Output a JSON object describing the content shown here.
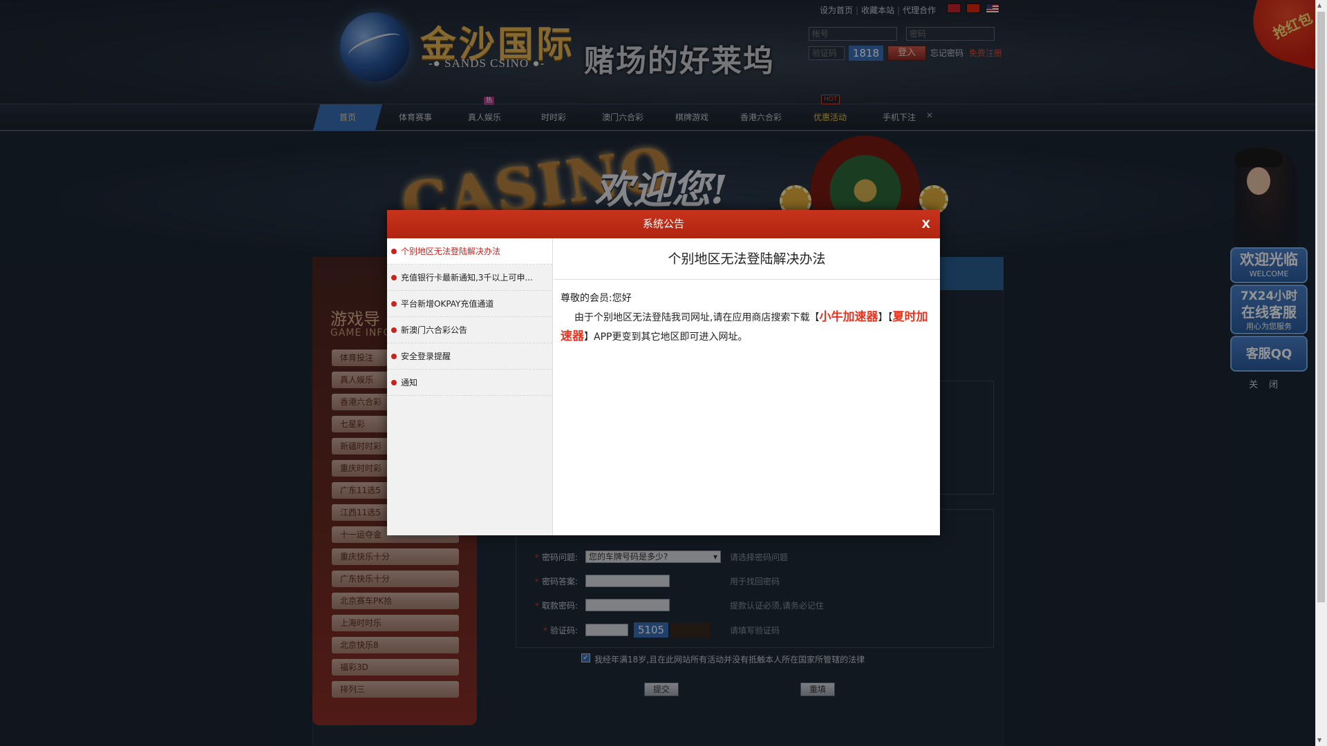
{
  "header": {
    "logo_cn": "金沙国际",
    "logo_en": "-● SANDS CSINO ●-",
    "slogan": "赌场的好莱坞",
    "top_links": [
      "设为首页",
      "收藏本站",
      "代理合作"
    ],
    "account_placeholder": "帐号",
    "password_placeholder": "密码",
    "captcha_label": "验证码",
    "captcha_code": "1818",
    "login_label": "登入",
    "forgot_label": "忘记密码",
    "register_label": "免费注册",
    "red_packet_label": "抢红包"
  },
  "nav": {
    "items": [
      "首页",
      "体育赛事",
      "真人娱乐",
      "时时彩",
      "澳门六合彩",
      "棋牌游戏",
      "香港六合彩",
      "优惠活动",
      "手机下注"
    ],
    "hot_cn_badge": "热",
    "hot_en_badge": "HOT",
    "close_glyph": "✕"
  },
  "banner": {
    "casino_text": "CASINO",
    "welcome_text": "欢迎您!"
  },
  "left_panel": {
    "title": "游戏导",
    "subtitle": "GAME INFO",
    "items": [
      "体育投注",
      "真人娱乐",
      "香港六合彩",
      "七星彩",
      "新疆时时彩",
      "重庆时时彩",
      "广东11选5",
      "江西11选5",
      "十一运夺金",
      "重庆快乐十分",
      "广东快乐十分",
      "北京赛车PK拾",
      "上海时时乐",
      "北京快乐8",
      "福彩3D",
      "排列三"
    ]
  },
  "form": {
    "security_question_label": "密码问题:",
    "security_question_value": "您的车牌号码是多少?",
    "security_question_hint": "请选择密码问题",
    "security_answer_label": "密码答案:",
    "security_answer_hint": "用于找回密码",
    "withdraw_password_label": "取款密码:",
    "withdraw_password_hint": "提款认证必须,请务必记住",
    "verify_label": "验证码:",
    "verify_code": "5105",
    "verify_hint": "请填写验证码",
    "agree_check": "✓",
    "agree_text": "我经年满18岁,且在此网站所有活动并没有抵触本人所在国家所管辖的法律",
    "submit_label": "提交",
    "reset_label": "重填"
  },
  "float_widget": {
    "welcome_big": "欢迎光临",
    "welcome_small": "WELCOME",
    "service_big1": "7X24小时",
    "service_big2": "在线客服",
    "service_small": "用心为您服务",
    "qq_label": "客服QQ",
    "close_label": "关闭"
  },
  "modal": {
    "title": "系统公告",
    "close_label": "X",
    "notices": [
      "个别地区无法登陆解决办法",
      "充值银行卡最新通知,3千以上可申...",
      "平台新增OKPAY充值通道",
      "新澳门六合彩公告",
      "安全登录提醒",
      "通知"
    ],
    "active_title": "个别地区无法登陆解决办法",
    "greeting": "尊敬的会员:您好",
    "body_part1": "由于个别地区无法登陆我司网址,请在应用商店搜索下载【",
    "highlight1": "小牛加速器",
    "body_part2": "】【",
    "highlight2": "夏时加速器",
    "body_part3": "】APP更变到其它地区即可进入网址。"
  },
  "colors": {
    "modal_header": "#c8331d",
    "highlight": "#e8341e",
    "nav_active": "#3a6fb5"
  }
}
